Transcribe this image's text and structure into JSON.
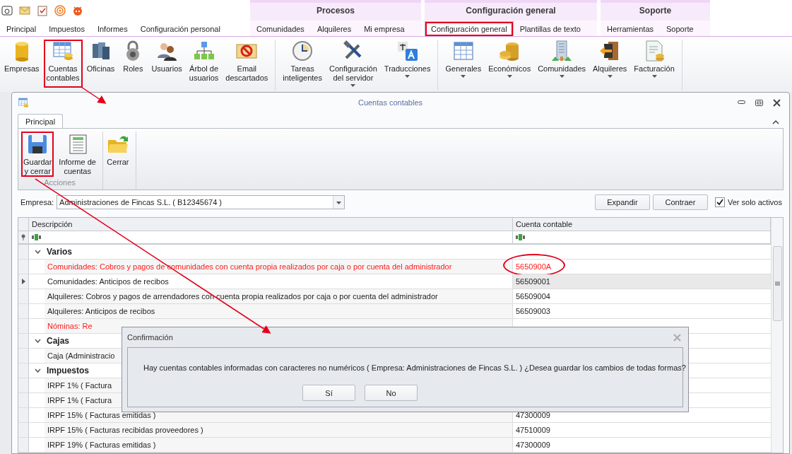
{
  "ribbon": {
    "plain_tabs": [
      {
        "label": "Principal",
        "selected": false,
        "highlighted": false
      },
      {
        "label": "Impuestos",
        "selected": false,
        "highlighted": false
      },
      {
        "label": "Informes",
        "selected": false,
        "highlighted": false
      },
      {
        "label": "Configuración personal",
        "selected": false,
        "highlighted": false
      }
    ],
    "context_groups": [
      {
        "title": "Procesos",
        "tabs": [
          {
            "label": "Comunidades",
            "selected": false,
            "highlighted": false
          },
          {
            "label": "Alquileres",
            "selected": false,
            "highlighted": false
          },
          {
            "label": "Mi empresa",
            "selected": false,
            "highlighted": false
          }
        ]
      },
      {
        "title": "Configuración general",
        "tabs": [
          {
            "label": "Configuración general",
            "selected": true,
            "highlighted": true
          },
          {
            "label": "Plantillas de texto",
            "selected": false,
            "highlighted": false
          }
        ]
      },
      {
        "title": "Soporte",
        "tabs": [
          {
            "label": "Herramientas",
            "selected": false,
            "highlighted": false
          },
          {
            "label": "Soporte",
            "selected": false,
            "highlighted": false
          }
        ]
      }
    ],
    "button_groups": [
      [
        {
          "label": "Empresas",
          "dropdown": false,
          "highlighted": false
        },
        {
          "label": "Cuentas\ncontables",
          "dropdown": false,
          "highlighted": true
        },
        {
          "label": "Oficinas",
          "dropdown": false,
          "highlighted": false
        },
        {
          "label": "Roles",
          "dropdown": false,
          "highlighted": false
        },
        {
          "label": "Usuarios",
          "dropdown": false,
          "highlighted": false
        },
        {
          "label": "Árbol de\nusuarios",
          "dropdown": false,
          "highlighted": false
        },
        {
          "label": "Email\ndescartados",
          "dropdown": false,
          "highlighted": false
        }
      ],
      [
        {
          "label": "Tareas\ninteligentes",
          "dropdown": false,
          "highlighted": false
        },
        {
          "label": "Configuración\ndel servidor",
          "dropdown": true,
          "highlighted": false
        },
        {
          "label": "Traducciones",
          "dropdown": true,
          "highlighted": false
        }
      ],
      [
        {
          "label": "Generales",
          "dropdown": true,
          "highlighted": false
        },
        {
          "label": "Económicos",
          "dropdown": true,
          "highlighted": false
        },
        {
          "label": "Comunidades",
          "dropdown": true,
          "highlighted": false
        },
        {
          "label": "Alquileres",
          "dropdown": true,
          "highlighted": false
        },
        {
          "label": "Facturación",
          "dropdown": true,
          "highlighted": false
        }
      ]
    ]
  },
  "window": {
    "title": "Cuentas contables",
    "tabs": [
      {
        "label": "Principal",
        "selected": true
      }
    ],
    "groups": [
      {
        "label": "Acciones",
        "buttons": [
          {
            "label": "Guardar\ny cerrar",
            "highlighted": true
          },
          {
            "label": "Informe de\ncuentas",
            "highlighted": false
          }
        ]
      },
      {
        "buttons": [
          {
            "label": "Cerrar",
            "highlighted": false
          }
        ]
      }
    ],
    "company_label": "Empresa:",
    "company_value": "Administraciones de Fincas S.L. ( B12345674 )",
    "buttons": [
      "Expandir",
      "Contraer"
    ],
    "active_only": {
      "label": "Ver solo activos",
      "checked": true
    },
    "grid": {
      "columns": [
        "Descripción",
        "Cuenta contable"
      ],
      "groups": [
        {
          "title": "Varios",
          "expanded": true,
          "rows": [
            {
              "description": "Comunidades: Cobros y pagos de comunidades con cuenta propia realizados por caja o por cuenta del administrador",
              "account": "5650900A",
              "error": true,
              "focused": false,
              "circled": true
            },
            {
              "description": "Comunidades: Anticipos de recibos",
              "account": "56509001",
              "error": false,
              "focused": true,
              "circled": false
            },
            {
              "description": "Alquileres: Cobros y pagos de arrendadores con cuenta propia realizados por caja o por cuenta del administrador",
              "account": "56509004",
              "error": false,
              "focused": false,
              "circled": false
            },
            {
              "description": "Alquileres: Anticipos de recibos",
              "account": "56509003",
              "error": false,
              "focused": false,
              "circled": false
            },
            {
              "description": "Nóminas: Re",
              "error": true,
              "focused": false,
              "circled": false
            }
          ]
        },
        {
          "title": "Cajas",
          "expanded": true,
          "rows": [
            {
              "description": "Caja (Administracio",
              "error": false,
              "focused": false,
              "circled": false
            }
          ]
        },
        {
          "title": "Impuestos",
          "expanded": true,
          "rows": [
            {
              "description": "IRPF 1% ( Factura",
              "error": false,
              "focused": false,
              "circled": false
            },
            {
              "description": "IRPF 1% ( Factura",
              "error": false,
              "focused": false,
              "circled": false
            },
            {
              "description": "IRPF 15% ( Facturas emitidas )",
              "account": "47300009",
              "error": false,
              "focused": false,
              "circled": false
            },
            {
              "description": "IRPF 15% ( Facturas recibidas proveedores )",
              "account": "47510009",
              "error": false,
              "focused": false,
              "circled": false
            },
            {
              "description": "IRPF 19% ( Facturas emitidas )",
              "account": "47300009",
              "error": false,
              "focused": false,
              "circled": false
            }
          ]
        }
      ]
    }
  },
  "dialog": {
    "title": "Confirmación",
    "message": "Hay cuentas contables informadas con caracteres no numéricos ( Empresa: Administraciones de Fincas S.L. ) ¿Desea guardar los cambios de todas formas?",
    "buttons": [
      "Sí",
      "No"
    ]
  }
}
